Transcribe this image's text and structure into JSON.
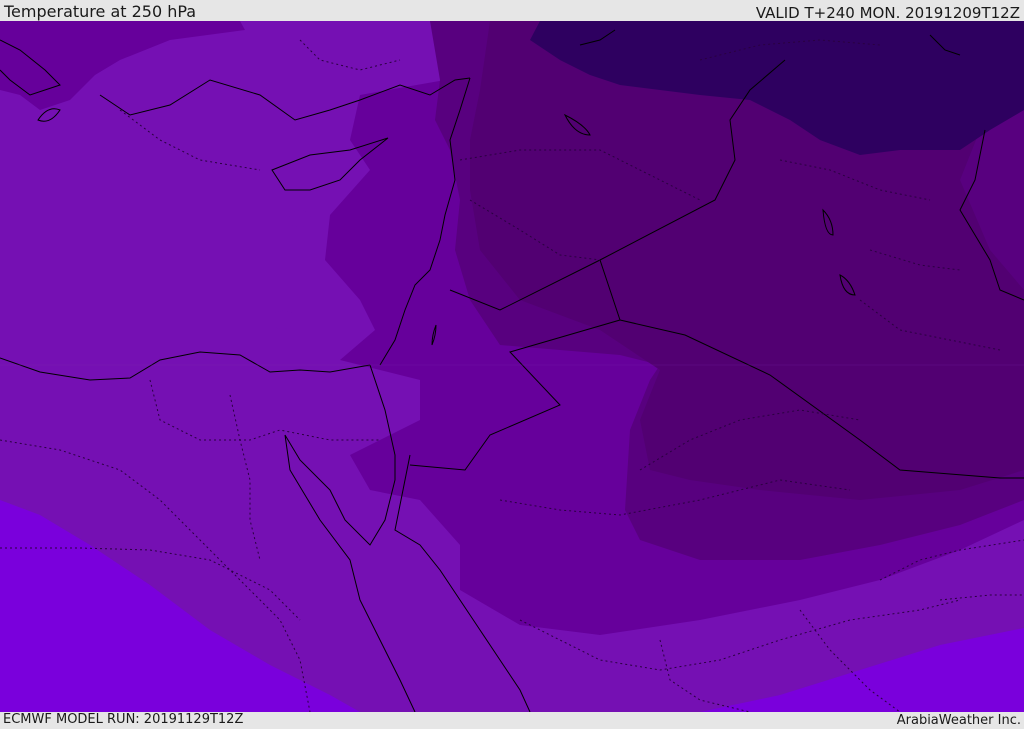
{
  "header": {
    "title": "Temperature at 250 hPa",
    "valid": "VALID T+240 MON. 20191209T12Z"
  },
  "footer": {
    "model_run": "ECMWF MODEL RUN: 20191129T12Z",
    "credit": "ArabiaWeather Inc."
  },
  "colors": {
    "band_warmest": "#7a00dc",
    "band_warm": "#7510b3",
    "band_mid": "#66009b",
    "band_cool": "#58007f",
    "band_cold": "#520072",
    "band_coldest": "#2e0060",
    "coastline": "#000000",
    "border_dotted": "#2a0040"
  }
}
